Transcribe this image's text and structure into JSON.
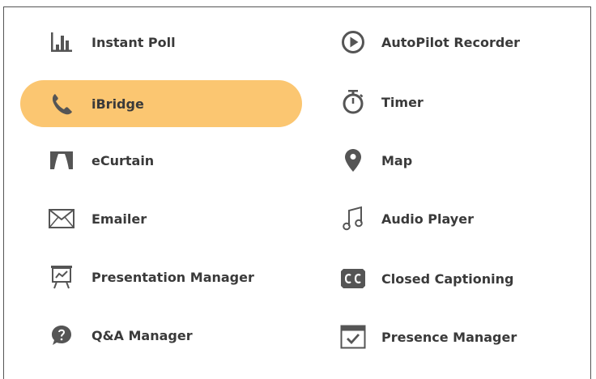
{
  "left_column": [
    {
      "label": "Instant Poll",
      "icon": "bar-chart-icon"
    },
    {
      "label": "iBridge",
      "icon": "phone-icon",
      "selected": true
    },
    {
      "label": "eCurtain",
      "icon": "curtain-icon"
    },
    {
      "label": "Emailer",
      "icon": "envelope-icon"
    },
    {
      "label": "Presentation Manager",
      "icon": "presentation-board-icon"
    },
    {
      "label": "Q&A Manager",
      "icon": "question-bubble-icon"
    }
  ],
  "right_column": [
    {
      "label": "AutoPilot Recorder",
      "icon": "play-circle-icon"
    },
    {
      "label": "Timer",
      "icon": "stopwatch-icon"
    },
    {
      "label": "Map",
      "icon": "map-pin-icon"
    },
    {
      "label": "Audio Player",
      "icon": "music-note-icon"
    },
    {
      "label": "Closed Captioning",
      "icon": "cc-icon"
    },
    {
      "label": "Presence Manager",
      "icon": "calendar-check-icon"
    }
  ],
  "colors": {
    "selected_background": "#fbc671",
    "icon": "#555555",
    "label": "#3a3a3a",
    "border": "#555555"
  }
}
